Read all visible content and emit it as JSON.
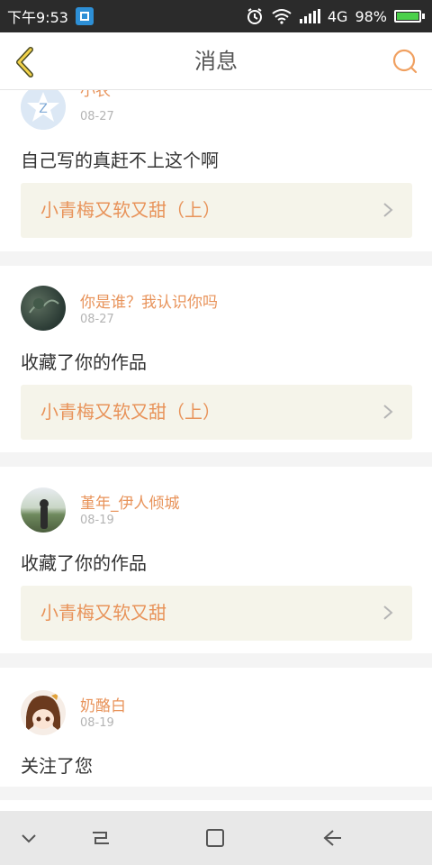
{
  "status_bar": {
    "time": "下午9:53",
    "network": "4G",
    "battery": "98%"
  },
  "header": {
    "title": "消息"
  },
  "messages": [
    {
      "user": "小农",
      "date": "08-27",
      "action": "自己写的真赶不上这个啊",
      "work": "小青梅又软又甜（上）"
    },
    {
      "user": "你是谁？我认识你吗",
      "date": "08-27",
      "action": "收藏了你的作品",
      "work": "小青梅又软又甜（上）"
    },
    {
      "user": "堇年_伊人倾城",
      "date": "08-19",
      "action": "收藏了你的作品",
      "work": "小青梅又软又甜"
    },
    {
      "user": "奶酪白",
      "date": "08-19",
      "action": "关注了您"
    }
  ]
}
